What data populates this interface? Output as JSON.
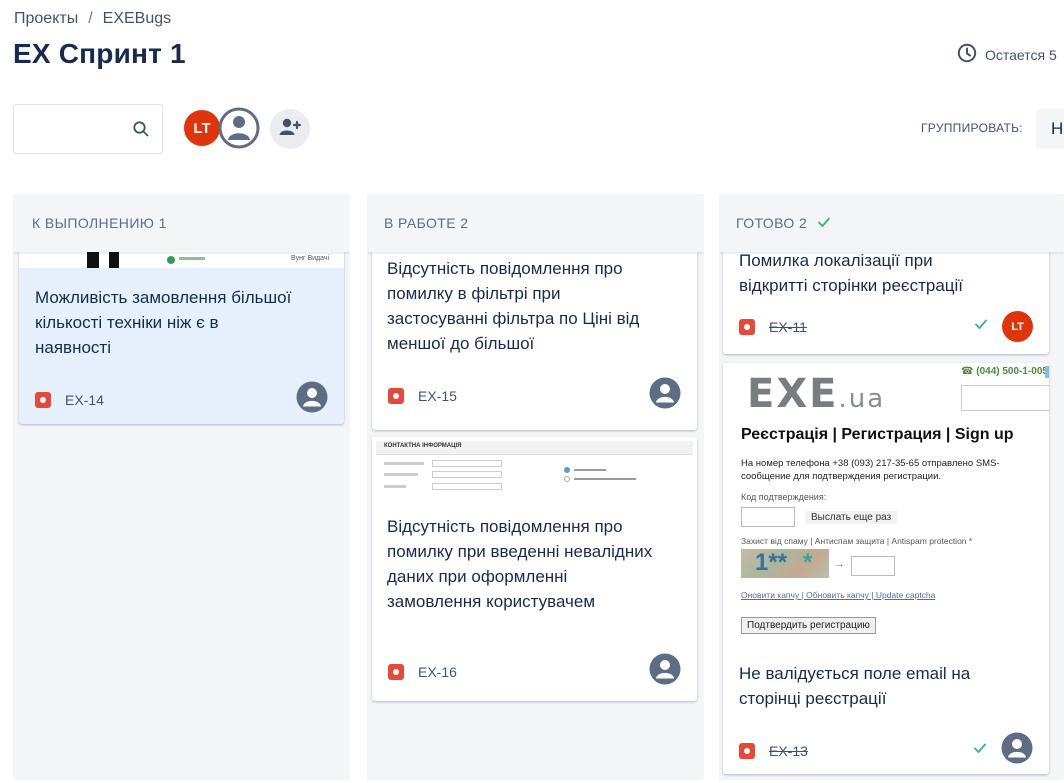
{
  "breadcrumb": {
    "items": [
      "Проекты",
      "EXEBugs"
    ],
    "separator": "/"
  },
  "page": {
    "title": "EX Спринт 1"
  },
  "header": {
    "time_remaining": "Остается 5"
  },
  "search": {
    "placeholder": "",
    "value": ""
  },
  "avatars": {
    "lt_initials": "LT"
  },
  "group_by": {
    "label": "ГРУППИРОВАТЬ:",
    "value": "Н"
  },
  "colors": {
    "accent": "#0052cc",
    "bug": "#e5493a",
    "avatar_lt": "#de350b",
    "done_check": "#36b37e"
  },
  "columns": [
    {
      "title": "К ВЫПОЛНЕНИЮ 1",
      "cards": [
        {
          "thumb_text": "Вунг Видачі",
          "title": "Можливість замовлення більшої кількості техніки ніж є в наявності",
          "key": "EX-14"
        }
      ]
    },
    {
      "title": "В РАБОТЕ 2",
      "cards": [
        {
          "title": "Відсутність повідомлення про помилку в фільтрі при застосуванні фільтра по Ціні від меншої до більшої",
          "key": "EX-15"
        },
        {
          "thumb_text": "КОНТАКТНА ІНФОРМАЦІЯ",
          "title": "Відсутність повідомлення про помилку при введенні невалідних даних при оформленні замовлення користувачем",
          "key": "EX-16"
        }
      ]
    },
    {
      "title": "ГОТОВО 2",
      "cards": [
        {
          "title": "Помилка локалізації при відкритті сторінки реєстрації",
          "key": "EX-11",
          "assignee": "LT"
        },
        {
          "title": "Не валідується поле email на сторінці реєстрації",
          "key": "EX-13",
          "thumb": {
            "phone": "(044) 500-1-005",
            "logo_main": "EXE",
            "logo_suffix": ".ua",
            "heading": "Реєстрація | Регистрация | Sign up",
            "message": "На номер телефона +38 (093) 217-35-65 отправлено SMS-сообщение для подтверждения регистрации.",
            "code_label": "Код подтверждения:",
            "resend": "Выслать еще раз",
            "spam_label": "Захист від спаму | Антиспам защита | Antispam protection *",
            "captcha_text": "1**",
            "captcha_links": "Оновити капчу | Обновить капчу | Update captcha",
            "confirm_button": "Подтвердить регистрацию"
          }
        }
      ]
    }
  ]
}
